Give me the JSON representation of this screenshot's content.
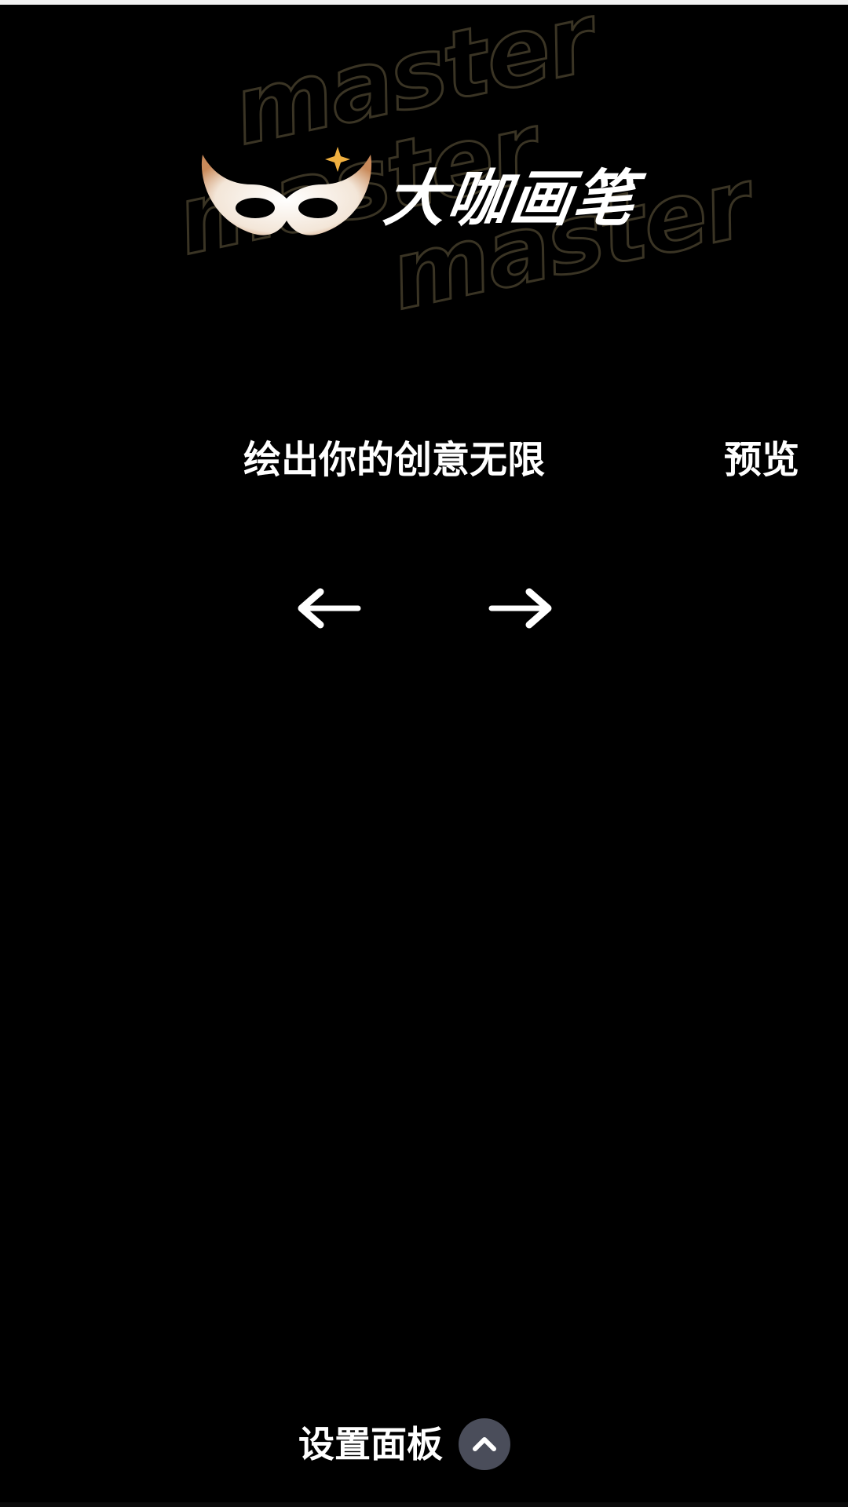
{
  "logo": {
    "watermark_text": "master",
    "title": "大咖画笔",
    "icon": "mask-icon"
  },
  "canvas": {
    "slogan": "绘出你的创意无限",
    "preview_label": "预览"
  },
  "navigation": {
    "prev_icon": "arrow-left-icon",
    "next_icon": "arrow-right-icon"
  },
  "settings_panel": {
    "label": "设置面板",
    "toggle_icon": "chevron-up-icon"
  },
  "colors": {
    "background": "#000000",
    "text": "#ffffff",
    "chevron_bg": "#4a4d5a",
    "watermark_stroke": "#3a3424",
    "sparkle": "#f0b040"
  }
}
